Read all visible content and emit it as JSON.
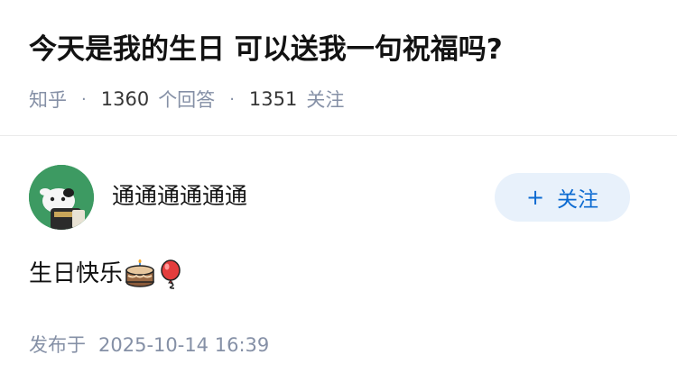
{
  "question": {
    "title": "今天是我的生日 可以送我一句祝福吗?",
    "source": "知乎",
    "separator": "·",
    "answer_count": "1360",
    "answer_label": "个回答",
    "follower_count": "1351",
    "follower_label": "关注"
  },
  "author": {
    "name": "通通通通通通",
    "follow_button": {
      "icon": "+",
      "label": "关注"
    }
  },
  "answer": {
    "text": "生日快乐",
    "emojis": [
      "birthday-cake-icon",
      "balloon-icon"
    ]
  },
  "publish": {
    "label": "发布于",
    "datetime": "2025-10-14 16:39"
  },
  "colors": {
    "meta_gray": "#8590a6",
    "follow_blue": "#0b6ad1",
    "follow_bg": "#e8f1fb",
    "avatar_green": "#3d9a62"
  }
}
